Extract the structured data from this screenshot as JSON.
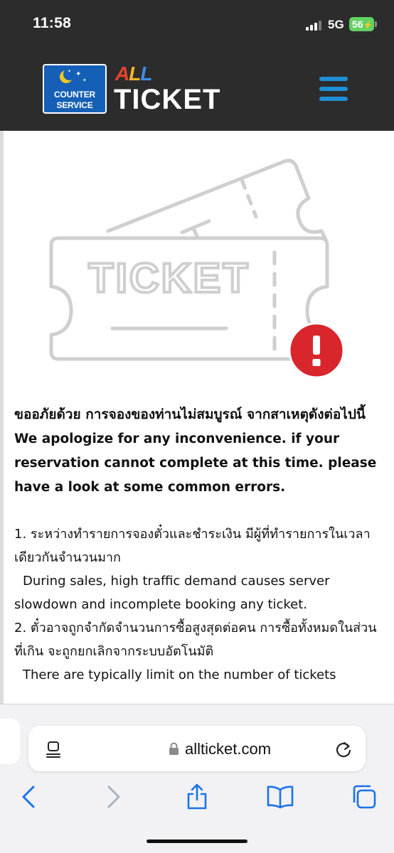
{
  "status_bar": {
    "time": "11:58",
    "network": "5G",
    "battery": "56"
  },
  "header": {
    "cs_logo_line1": "COUNTER",
    "cs_logo_line2": "SERVICE",
    "brand_all": "ALL",
    "brand_ticket": "TICKET",
    "all_colors": [
      "#e8452c",
      "#f7b728",
      "#3f8ee6"
    ],
    "menu_color": "#1e8fd6"
  },
  "hero": {
    "ticket_word": "TICKET",
    "alert_symbol": "!",
    "alert_color": "#d9262c"
  },
  "content": {
    "thai_title": "ขออภัยด้วย การจองของท่านไม่สมบูรณ์ จากสาเหตุดังต่อไปนี้",
    "en_title": "We apologize for any inconvenience. if your reservation cannot complete at this time. please have a look at some common errors.",
    "items": [
      {
        "thai": "1. ระหว่างทำรายการจองตั๋วและชำระเงิน มีผู้ที่ทำรายการในเวลาเดียวกันจำนวนมาก",
        "en": "During sales, high traffic demand causes server slowdown and incomplete booking any ticket."
      },
      {
        "thai": "2. ตั๋วอาจถูกจำกัดจำนวนการซื้อสูงสุดต่อคน การซื้อทั้งหมดในส่วนที่เกิน จะถูกยกเลิกจากระบบอัตโนมัติ",
        "en": "There are typically limit on the number of tickets"
      }
    ]
  },
  "browser": {
    "url": "allticket.com",
    "toolbar": [
      "back-icon",
      "forward-icon",
      "share-icon",
      "bookmarks-icon",
      "tabs-icon"
    ],
    "accent": "#1a73e8"
  }
}
